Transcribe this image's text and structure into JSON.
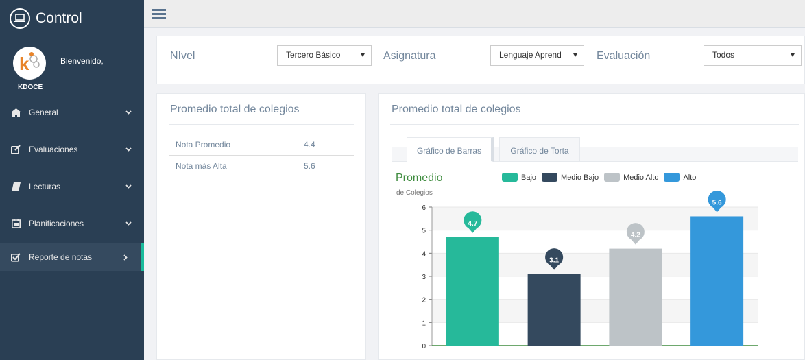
{
  "brand": {
    "title": "Control",
    "icon": "laptop-icon"
  },
  "profile": {
    "welcome": "Bienvenido,",
    "name": "KDOCE",
    "logo_text": "k"
  },
  "sidebar": {
    "items": [
      {
        "label": "General",
        "icon": "home-icon",
        "chevron": "chevron-down-icon"
      },
      {
        "label": "Evaluaciones",
        "icon": "edit-icon",
        "chevron": "chevron-down-icon"
      },
      {
        "label": "Lecturas",
        "icon": "book-icon",
        "chevron": "chevron-down-icon"
      },
      {
        "label": "Planificaciones",
        "icon": "calendar-icon",
        "chevron": "chevron-down-icon"
      },
      {
        "label": "Reporte de notas",
        "icon": "check-square-icon",
        "chevron": "chevron-right-icon"
      }
    ]
  },
  "filters": {
    "nivel_label": "NIvel",
    "nivel_value": "Tercero Básico",
    "asignatura_label": "Asignatura",
    "asignatura_value": "Lenguaje Aprend",
    "evaluacion_label": "Evaluación",
    "evaluacion_value": "Todos"
  },
  "left_panel": {
    "title": "Promedio total de colegios",
    "rows": [
      {
        "label": "Nota Promedio",
        "value": "4.4"
      },
      {
        "label": "Nota más Alta",
        "value": "5.6"
      }
    ]
  },
  "right_panel": {
    "title": "Promedio total de colegios",
    "tabs": [
      "Gráfico de Barras",
      "Gráfico de Torta"
    ]
  },
  "colors": {
    "bajo": "#26b99a",
    "medio_bajo": "#34495e",
    "medio_alto": "#bdc3c7",
    "alto": "#3498db",
    "sidebar": "#2a3f54"
  },
  "chart_data": {
    "type": "bar",
    "title": "Promedio",
    "subtitle": "de Colegios",
    "categories": [
      "Bajo",
      "Medio Bajo",
      "Medio Alto",
      "Alto"
    ],
    "values": [
      4.7,
      3.1,
      4.2,
      5.6
    ],
    "data_labels": [
      "4.7",
      "3.1",
      "4.2",
      "5.6"
    ],
    "ylim": [
      0,
      6
    ],
    "yticks": [
      "0",
      "1",
      "2",
      "3",
      "4",
      "5",
      "6"
    ],
    "legend": [
      "Bajo",
      "Medio Bajo",
      "Medio Alto",
      "Alto"
    ],
    "legend_position": "top",
    "grid": true
  }
}
